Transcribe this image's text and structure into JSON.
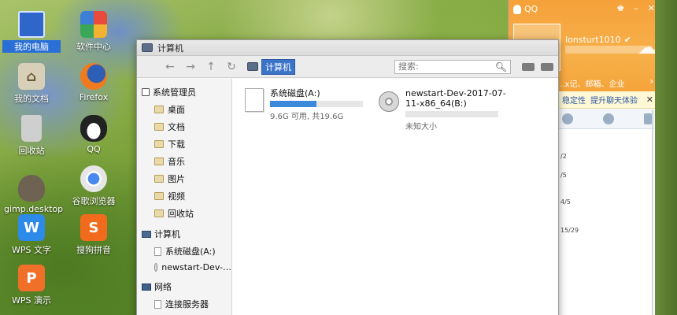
{
  "desktop": {
    "icons": [
      {
        "label": "我的电脑",
        "icon": "monitor-icon",
        "selected": true
      },
      {
        "label": "软件中心",
        "icon": "software-center-icon"
      },
      {
        "label": "我的文档",
        "icon": "home-folder-icon"
      },
      {
        "label": "Firefox",
        "icon": "firefox-icon"
      },
      {
        "label": "回收站",
        "icon": "trash-icon"
      },
      {
        "label": "QQ",
        "icon": "qq-penguin-icon"
      },
      {
        "label": "gimp.desktop",
        "icon": "gimp-icon"
      },
      {
        "label": "谷歌浏览器",
        "icon": "chrome-icon"
      },
      {
        "label": "WPS 文字",
        "icon": "wps-writer-icon"
      },
      {
        "label": "搜狗拼音",
        "icon": "sogou-icon"
      },
      {
        "label": "WPS 演示",
        "icon": "wps-presentation-icon"
      }
    ]
  },
  "file_manager": {
    "title": "计算机",
    "breadcrumb": "计算机",
    "search_placeholder": "搜索:",
    "sidebar": {
      "groups": [
        {
          "label": "系统管理员",
          "items": [
            "桌面",
            "文档",
            "下载",
            "音乐",
            "图片",
            "视频",
            "回收站"
          ]
        },
        {
          "label": "计算机",
          "items": [
            "系统磁盘(A:)",
            "newstart-Dev-…"
          ]
        },
        {
          "label": "网络",
          "items": [
            "连接服务器"
          ]
        }
      ]
    },
    "drives": [
      {
        "name": "系统磁盘(A:)",
        "sub": "9.6G 可用, 共19.6G",
        "used_fraction": 0.5
      },
      {
        "name": "newstart-Dev-2017-07-11-x86_64(B:)",
        "sub": "未知大小",
        "used_fraction": 0
      }
    ]
  },
  "qq": {
    "title": "QQ",
    "nickname": "lonsturt1010",
    "tabs_hint": "...ⅹ记、邮箱、企业",
    "notice_1": "稳定性",
    "notice_2": "提升聊天体验",
    "list_labels": [
      "/2",
      "/5",
      "4/5",
      "15/29"
    ]
  },
  "colors": {
    "selection": "#3b74c8",
    "qq_orange": "#f6a13a",
    "progress": "#3b8ad9"
  }
}
